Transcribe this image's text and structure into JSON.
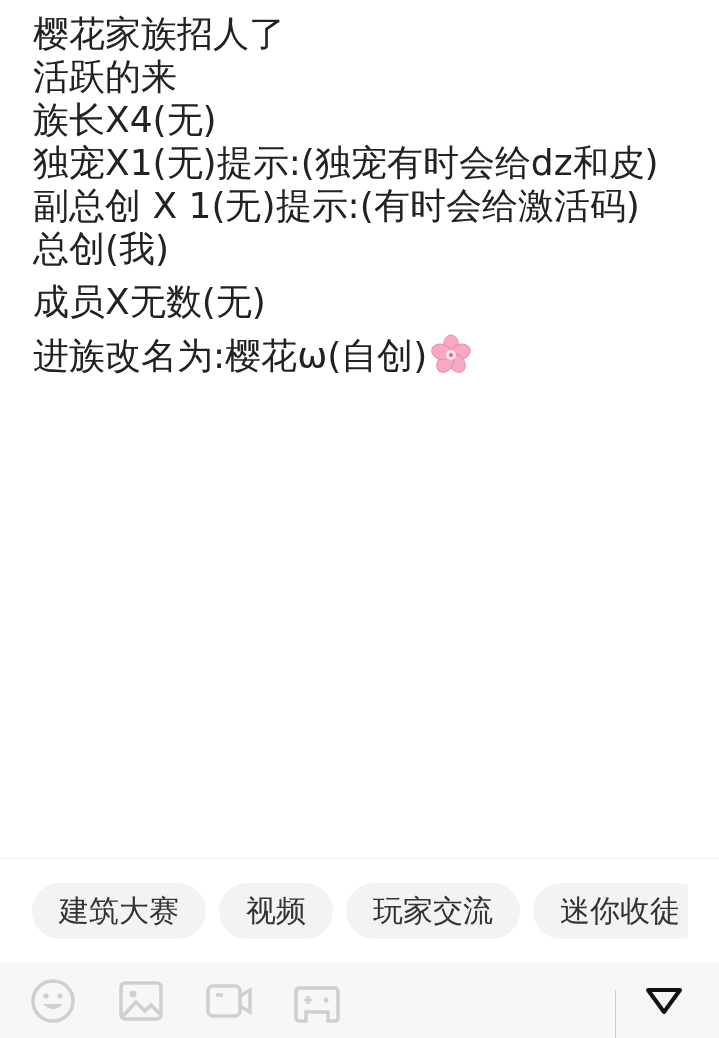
{
  "post": {
    "paragraphs": [
      [
        "樱花家族招人了",
        "活跃的来",
        "族长X4(无)",
        "独宠X1(无)提示:(独宠有时会给dz和皮)",
        "副总创 X 1(无)提示:(有时会给激活码)",
        "总创(我)"
      ],
      [
        "成员X无数(无)"
      ],
      [
        "进族改名为:樱花ω(自创)"
      ]
    ]
  },
  "tags": [
    "建筑大赛",
    "视频",
    "玩家交流",
    "迷你收徒"
  ]
}
